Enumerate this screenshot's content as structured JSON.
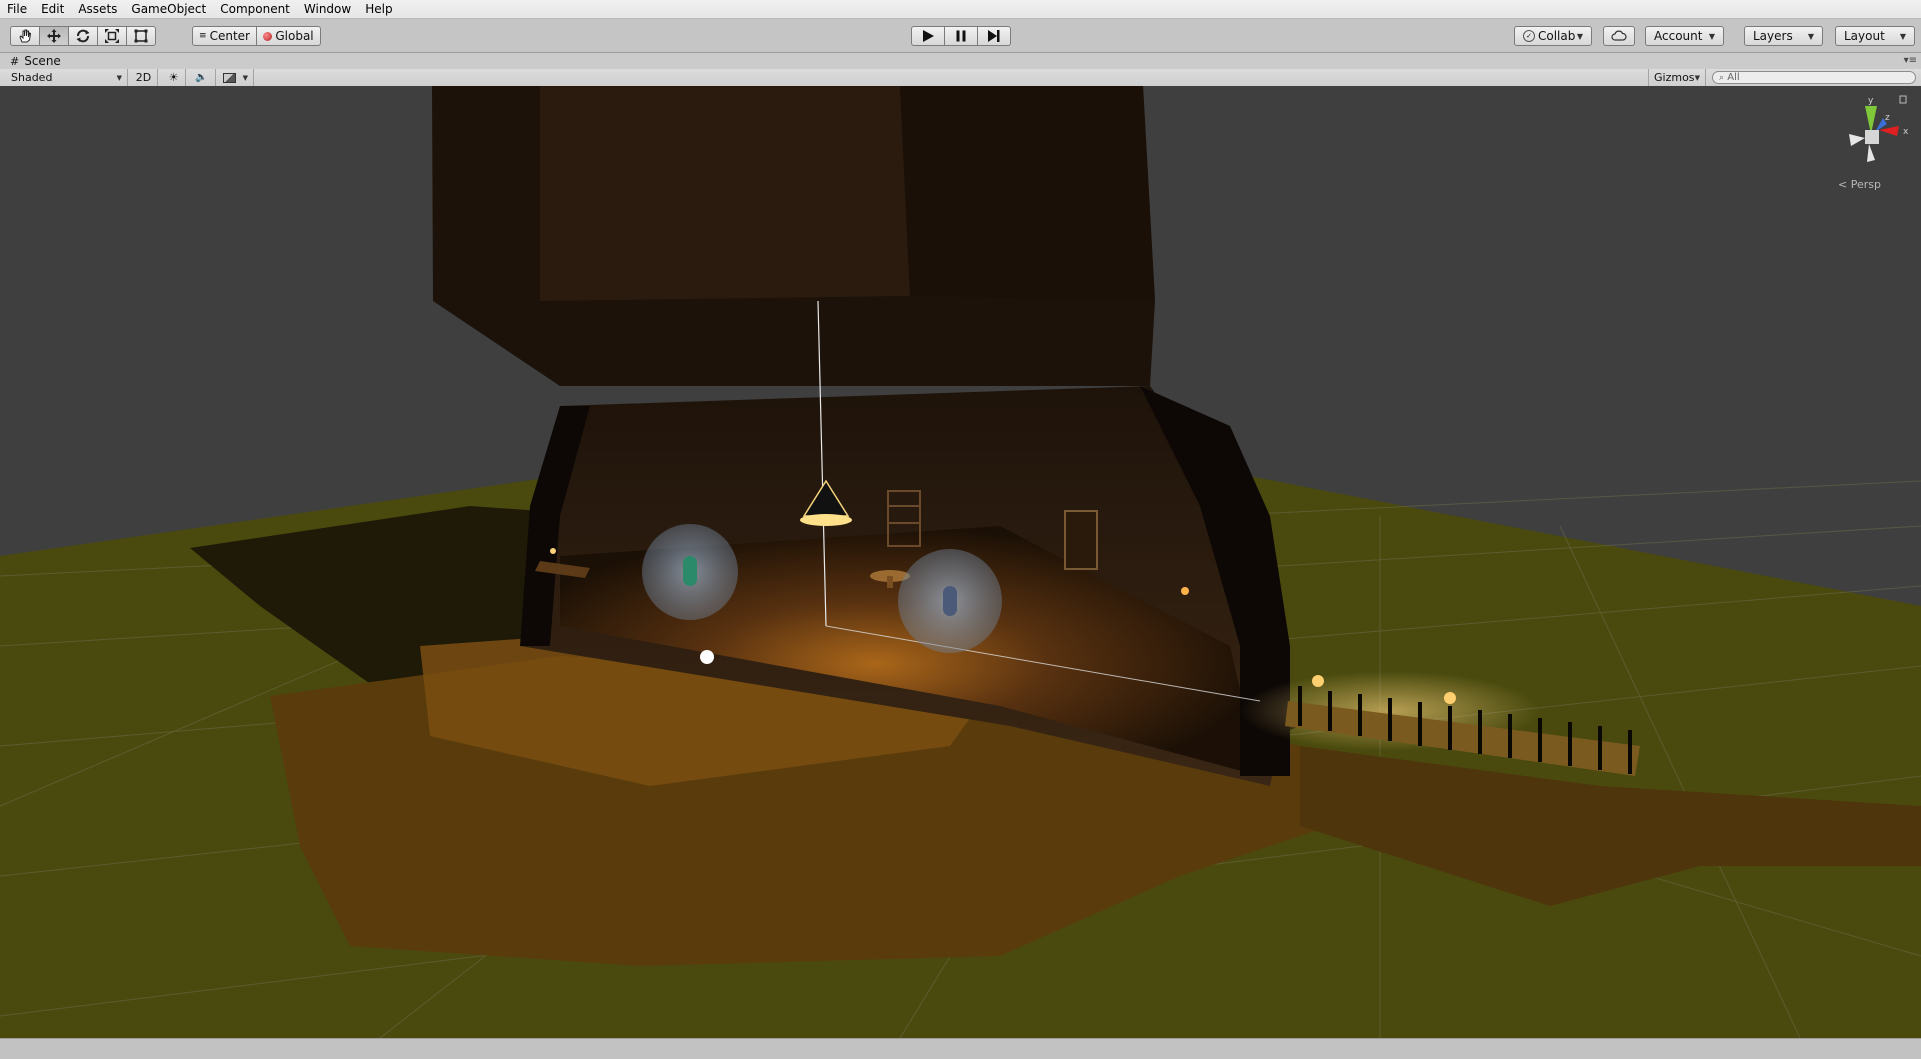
{
  "menu": {
    "items": [
      "File",
      "Edit",
      "Assets",
      "GameObject",
      "Component",
      "Window",
      "Help"
    ]
  },
  "toolbar": {
    "transform_tools": [
      "hand-icon",
      "move-icon",
      "rotate-icon",
      "scale-icon",
      "rect-icon"
    ],
    "active_tool": "move-icon",
    "pivot_label": "Center",
    "space_label": "Global",
    "play_controls": [
      "play-icon",
      "pause-icon",
      "step-icon"
    ],
    "collab_label": "Collab",
    "account_label": "Account",
    "layers_label": "Layers",
    "layout_label": "Layout"
  },
  "scene_tab": {
    "label": "Scene"
  },
  "scene_toolbar": {
    "draw_mode": "Shaded",
    "mode_2d": "2D",
    "gizmos_label": "Gizmos",
    "search_placeholder": "All"
  },
  "viewport": {
    "projection_label": "Persp",
    "axis_labels": {
      "y": "y",
      "z": "z",
      "x": "x"
    },
    "colors": {
      "sky": "#3e3e3e",
      "ground": "#4a4a0f",
      "axis_x": "#e02020",
      "axis_y": "#7ec83a",
      "axis_z": "#3a6fd8"
    }
  }
}
